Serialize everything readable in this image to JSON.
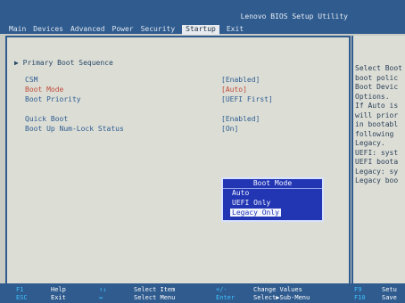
{
  "header": {
    "brand": "Lenovo BIOS Setup Utility",
    "tabs": [
      "Main",
      "Devices",
      "Advanced",
      "Power",
      "Security",
      "Startup",
      "Exit"
    ]
  },
  "main": {
    "section": "▶ Primary Boot Sequence",
    "rows": [
      {
        "label": "CSM",
        "value": "[Enabled]"
      },
      {
        "label": "Boot Mode",
        "value": "[Auto]"
      },
      {
        "label": "Boot Priority",
        "value": "[UEFI First]"
      },
      {
        "label": "Quick Boot",
        "value": "[Enabled]"
      },
      {
        "label": "Boot Up Num-Lock Status",
        "value": "[On]"
      }
    ]
  },
  "popup": {
    "title": "Boot Mode",
    "options": [
      "Auto",
      "UEFI Only",
      "Legacy Only"
    ]
  },
  "help": {
    "text": "Select Boot\nboot polic\nBoot Devic\nOptions.\nIf Auto is\nwill prior\nin bootabl\nfollowing\nLegacy.\nUEFI: syst\nUEFI boota\nLegacy: sy\nLegacy boo"
  },
  "footer": {
    "items": [
      {
        "key": "F1",
        "action": "Help"
      },
      {
        "key": "ESC",
        "action": "Exit"
      },
      {
        "key": "↑↓",
        "action": "Select Item"
      },
      {
        "key": "↔",
        "action": "Select Menu"
      },
      {
        "key": "+/-",
        "action": "Change Values"
      },
      {
        "key": "Enter",
        "action": "Select▶Sub-Menu"
      },
      {
        "key": "F9",
        "action": "Setu"
      },
      {
        "key": "F10",
        "action": "Save"
      }
    ]
  },
  "colors": {
    "accent": "#2f5b8e",
    "popup": "#2236b4",
    "selected": "#c34a39"
  }
}
